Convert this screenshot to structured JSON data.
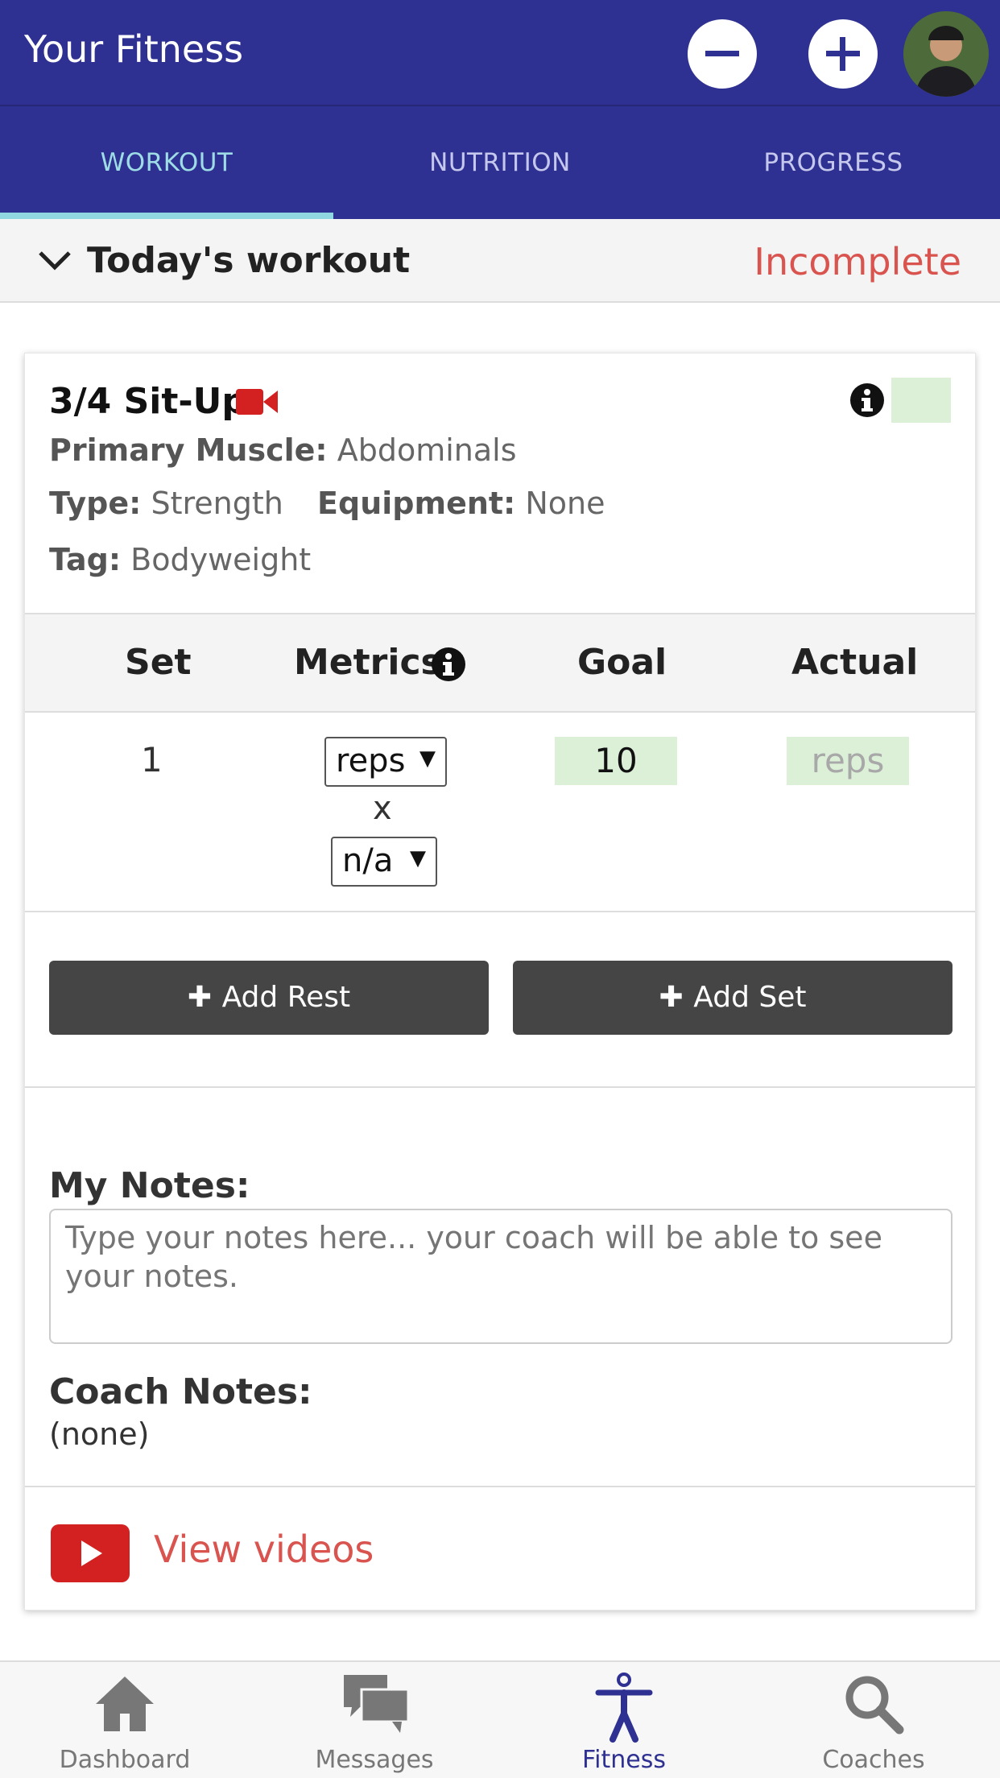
{
  "header": {
    "title": "Your Fitness",
    "minus_icon": "minus-circle-icon",
    "plus_icon": "plus-circle-icon",
    "avatar": "user-avatar"
  },
  "tabs": [
    {
      "label": "WORKOUT",
      "active": true
    },
    {
      "label": "NUTRITION",
      "active": false
    },
    {
      "label": "PROGRESS",
      "active": false
    }
  ],
  "today": {
    "title": "Today's workout",
    "status": "Incomplete"
  },
  "exercise": {
    "name": "3/4 Sit-Up",
    "primary_muscle_label": "Primary Muscle:",
    "primary_muscle": "Abdominals",
    "type_label": "Type:",
    "type": "Strength",
    "equipment_label": "Equipment:",
    "equipment": "None",
    "tag_label": "Tag:",
    "tag": "Bodyweight"
  },
  "table": {
    "headers": [
      "Set",
      "Metrics",
      "Goal",
      "Actual"
    ],
    "rows": [
      {
        "set": "1",
        "metric1": "reps",
        "x": "x",
        "metric2": "n/a",
        "goal": "10",
        "actual_placeholder": "reps"
      }
    ]
  },
  "buttons": {
    "add_rest": "Add Rest",
    "add_set": "Add Set"
  },
  "notes": {
    "my_label": "My Notes:",
    "my_placeholder": "Type your notes here... your coach will be able to see your notes.",
    "coach_label": "Coach Notes:",
    "coach_value": "(none)"
  },
  "videos": {
    "label": "View videos"
  },
  "bottom_nav": [
    {
      "label": "Dashboard",
      "icon": "home-icon",
      "active": false
    },
    {
      "label": "Messages",
      "icon": "chat-icon",
      "active": false
    },
    {
      "label": "Fitness",
      "icon": "person-icon",
      "active": true
    },
    {
      "label": "Coaches",
      "icon": "search-icon",
      "active": false
    }
  ],
  "colors": {
    "primary": "#2e3191",
    "active_tab": "#9fdde6",
    "danger": "#d9534f",
    "green_field": "#dcf0d8",
    "dark_button": "#454545"
  }
}
